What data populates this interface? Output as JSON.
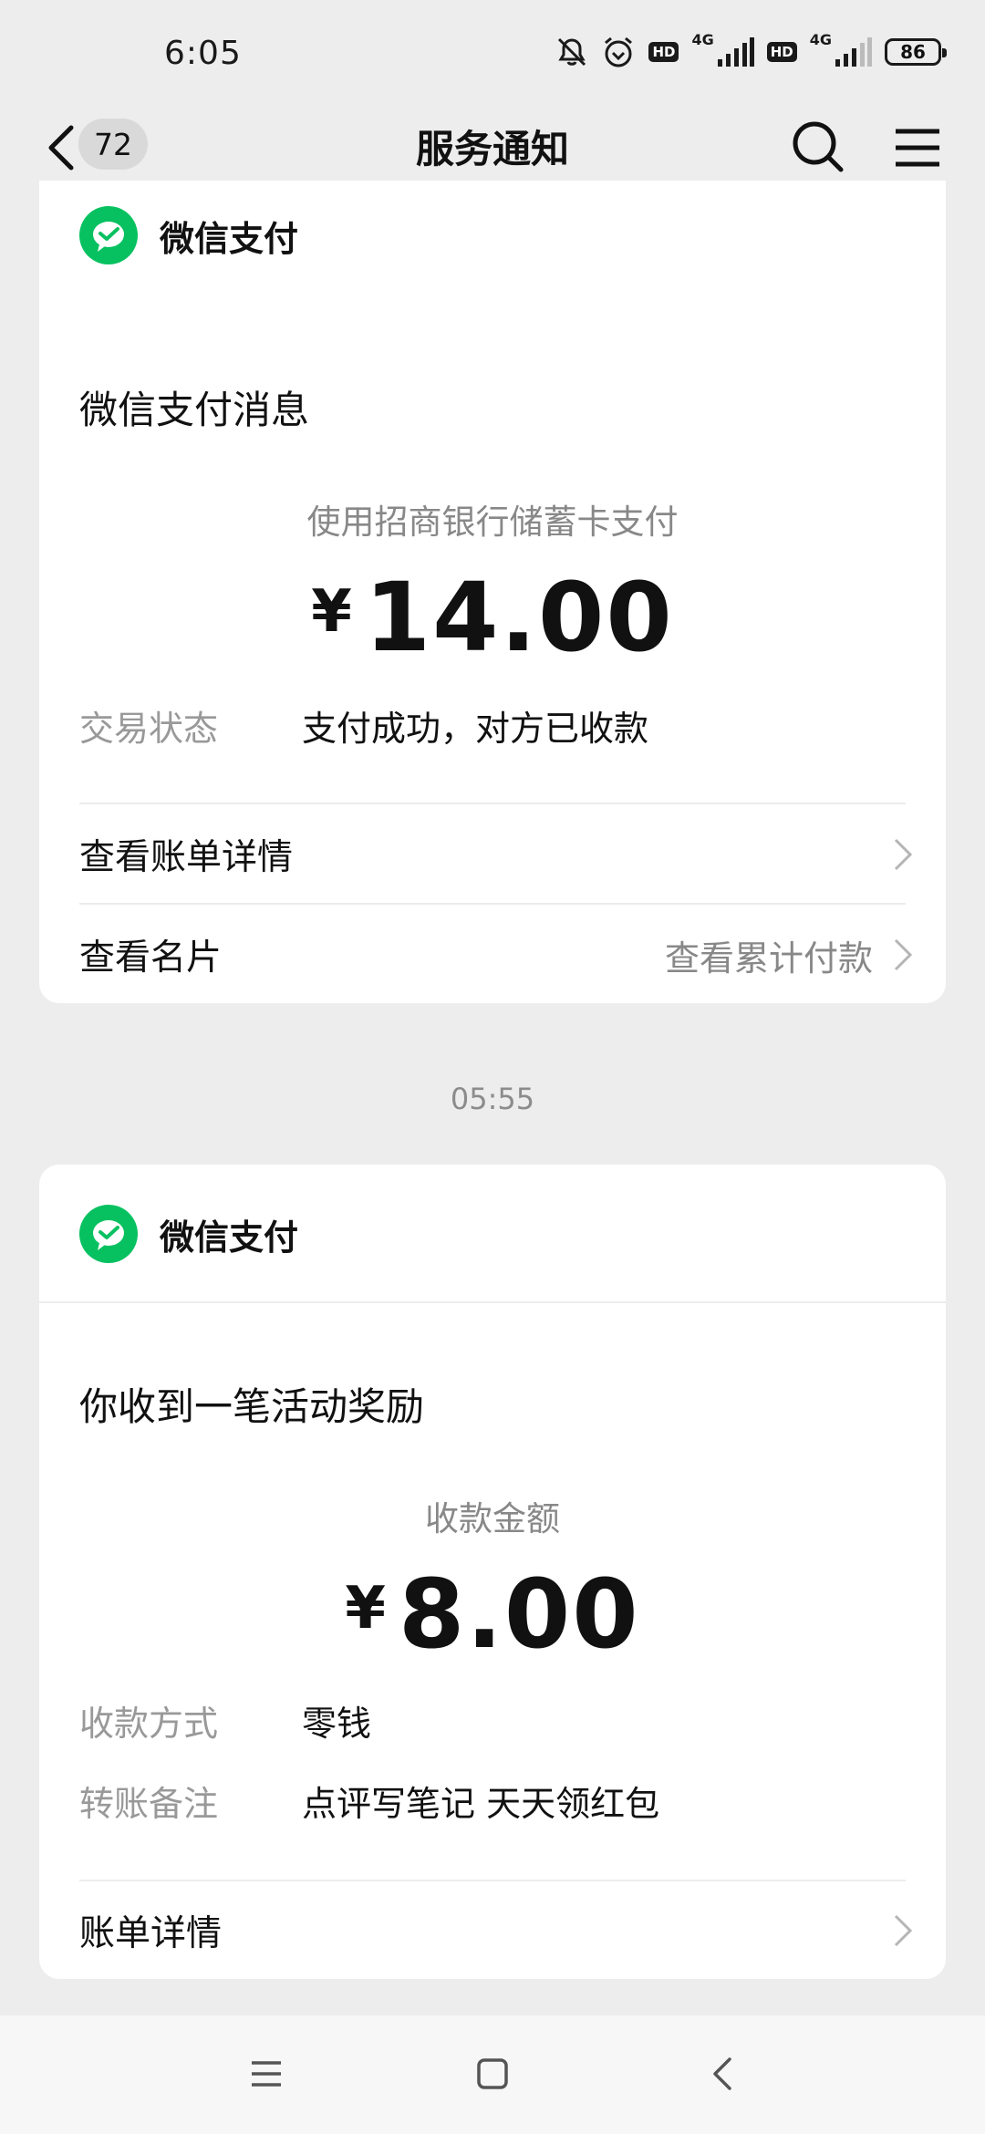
{
  "status_bar": {
    "time": "6:05",
    "hd1": "HD",
    "net1": "4G",
    "hd2": "HD",
    "net2": "4G",
    "battery": "86"
  },
  "nav": {
    "unread_count": "72",
    "title": "服务通知"
  },
  "card1": {
    "sender": "微信支付",
    "message_title": "微信支付消息",
    "payment_method": "使用招商银行储蓄卡支付",
    "currency": "¥",
    "amount": "14.00",
    "status_label": "交易状态",
    "status_value": "支付成功，对方已收款",
    "row1_label": "查看账单详情",
    "row2_label": "查看名片",
    "row2_extra": "查看累计付款"
  },
  "time_separator": "05:55",
  "card2": {
    "sender": "微信支付",
    "message_title": "你收到一笔活动奖励",
    "amount_label": "收款金额",
    "currency": "¥",
    "amount": "8.00",
    "method_label": "收款方式",
    "method_value": "零钱",
    "note_label": "转账备注",
    "note_value": "点评写笔记 天天领红包",
    "row_label": "账单详情"
  },
  "colors": {
    "wechat_green": "#07c160",
    "background": "#ededed"
  }
}
